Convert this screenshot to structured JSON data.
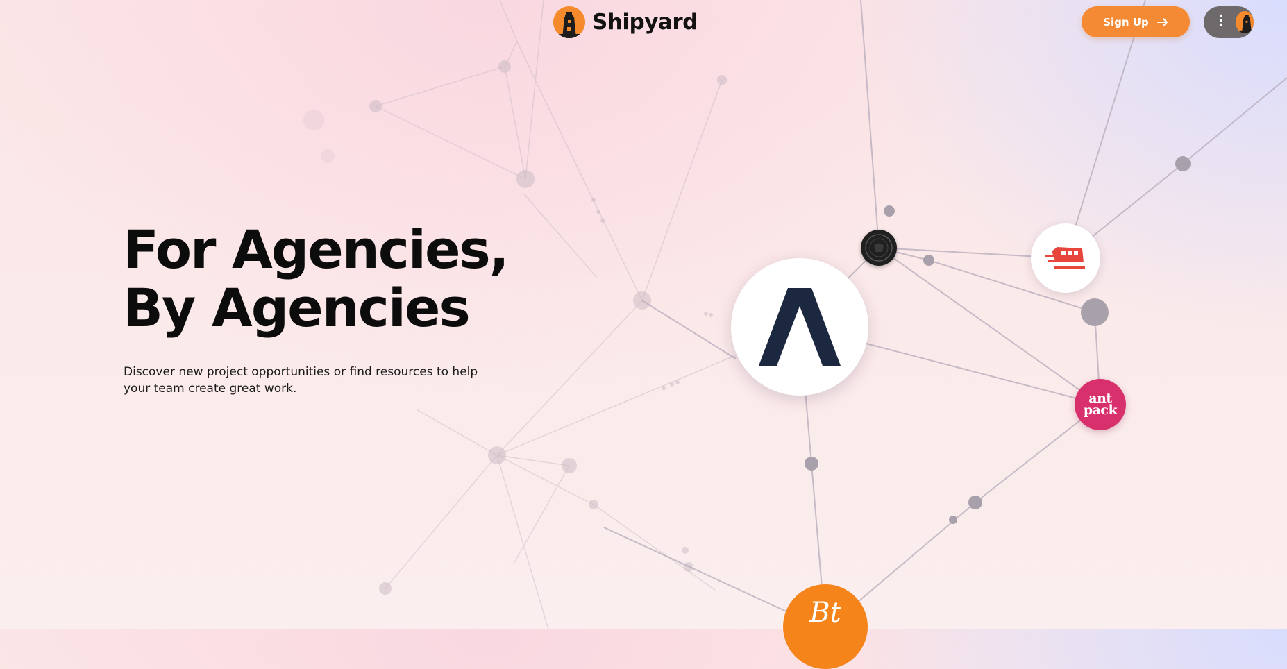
{
  "header": {
    "brand_name": "Shipyard",
    "brand_logo_icon": "lighthouse-icon",
    "signup_label": "Sign Up",
    "signup_icon": "arrow-right-icon",
    "menu_icon": "vertical-dots-icon",
    "avatar_icon": "lighthouse-icon"
  },
  "hero": {
    "title_line1": "For Agencies,",
    "title_line2": "By Agencies",
    "description": "Discover new project opportunities or find resources to help your team create great work."
  },
  "network": {
    "nodes": [
      {
        "name": "aspect-logo-node",
        "icon": "aspect-a-icon"
      },
      {
        "name": "seal-logo-node",
        "icon": "seal-icon"
      },
      {
        "name": "bus-logo-node",
        "icon": "bus-icon"
      },
      {
        "name": "antpack-logo-node",
        "label_line1": "ant",
        "label_line2": "pack"
      },
      {
        "name": "orange-logo-node",
        "label": "Bt"
      }
    ]
  },
  "colors": {
    "accent": "#f58a35",
    "text": "#0c0c0c",
    "menu_bg": "#6e6a6b",
    "antpack": "#d8306c",
    "aspect_navy": "#1c2740"
  }
}
